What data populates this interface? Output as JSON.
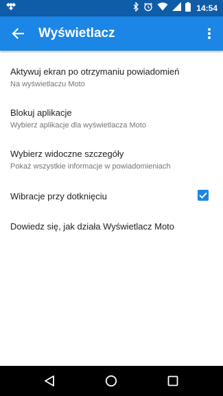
{
  "status_bar": {
    "time": "14:54",
    "left_icons": [
      "tidal-icon"
    ],
    "right_icons": [
      "bluetooth-icon",
      "alarm-icon",
      "wifi-icon",
      "signal-icon",
      "battery-icon"
    ]
  },
  "app_bar": {
    "title": "Wyświetlacz",
    "color": "#1B86E5",
    "status_color": "#0F5CA8"
  },
  "settings": {
    "items": [
      {
        "primary": "Aktywuj ekran po otrzymaniu powiadomień",
        "secondary": "Na wyświetlaczu Moto"
      },
      {
        "primary": "Blokuj aplikacje",
        "secondary": "Wybierz aplikacje dla wyświetlacza Moto"
      },
      {
        "primary": "Wybierz widoczne szczegóły",
        "secondary": "Pokaż wszystkie informacje w powiadomieniach"
      },
      {
        "primary": "Wibracje przy dotknięciu",
        "checked": true
      },
      {
        "primary": "Dowiedz się, jak działa Wyświetlacz Moto"
      }
    ]
  },
  "nav_bar": {
    "buttons": [
      "back-icon",
      "home-icon",
      "recents-icon"
    ]
  }
}
